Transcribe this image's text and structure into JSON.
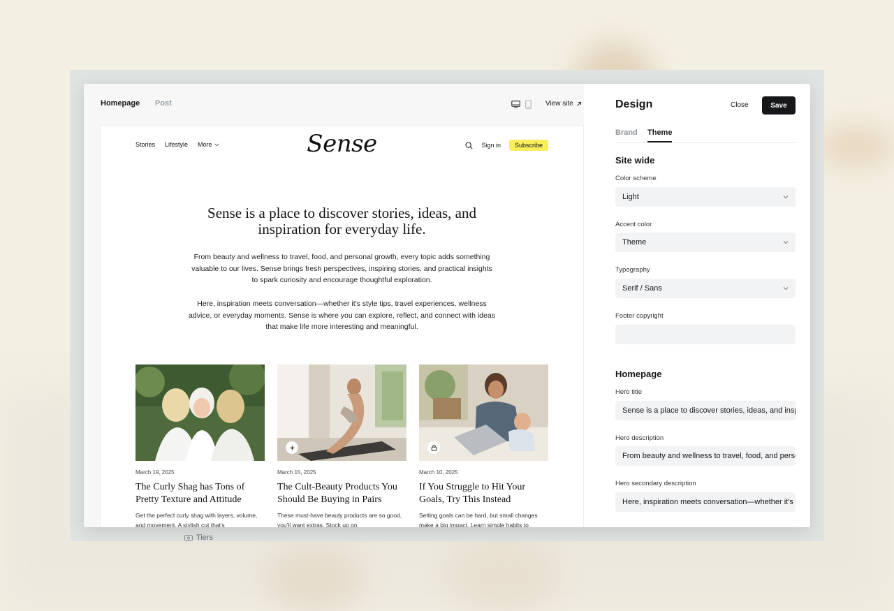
{
  "editor": {
    "tabs": [
      {
        "label": "Homepage"
      },
      {
        "label": "Post"
      }
    ],
    "view_site_label": "View site"
  },
  "site": {
    "nav": [
      {
        "label": "Stories"
      },
      {
        "label": "Lifestyle"
      },
      {
        "label": "More"
      }
    ],
    "logo": "Sense",
    "sign_in_label": "Sign in",
    "subscribe_label": "Subscribe",
    "subscribe_color": "#f9ee5c",
    "hero_title": "Sense is a place to discover stories, ideas, and inspiration for everyday life.",
    "hero_description": "From beauty and wellness to travel, food, and personal growth, every topic adds something valuable to our lives. Sense brings fresh perspectives, inspiring stories, and practical insights to spark curiosity and encourage thoughtful exploration.",
    "hero_secondary_description": "Here, inspiration meets conversation—whether it's style tips, travel experiences, wellness advice, or everyday moments. Sense is where you can explore, reflect, and connect with ideas that make life more interesting and meaningful.",
    "posts": [
      {
        "date": "March 19, 2025",
        "title": "The Curly Shag has Tons of Pretty Texture and Attitude",
        "excerpt": "Get the perfect curly shag with layers, volume, and movement. A stylish cut that's",
        "badge_icon": ""
      },
      {
        "date": "March 15, 2025",
        "title": "The Cult-Beauty Products You Should Be Buying in Pairs",
        "excerpt": "These must-have beauty products are so good, you'll want extras. Stock up on",
        "badge_icon": "sparkle-icon"
      },
      {
        "date": "March 10, 2025",
        "title": "If You Struggle to Hit Your Goals, Try This Instead",
        "excerpt": "Setting goals can be hard, but small changes make a big impact. Learn simple habits to",
        "badge_icon": "lock-icon"
      }
    ]
  },
  "design_panel": {
    "title": "Design",
    "close_label": "Close",
    "save_label": "Save",
    "tabs": [
      {
        "label": "Brand"
      },
      {
        "label": "Theme"
      }
    ],
    "active_tab": "Theme",
    "site_wide": {
      "title": "Site wide",
      "color_scheme_label": "Color scheme",
      "color_scheme_value": "Light",
      "accent_color_label": "Accent color",
      "accent_color_value": "Theme",
      "typography_label": "Typography",
      "typography_value": "Serif / Sans",
      "footer_copyright_label": "Footer copyright",
      "footer_copyright_value": ""
    },
    "homepage": {
      "title": "Homepage",
      "hero_title_label": "Hero title",
      "hero_title_value": "Sense is a place to discover stories, ideas, and inspiration for everyday life.",
      "hero_description_label": "Hero description",
      "hero_description_value": "From beauty and wellness to travel, food, and personal growth, every topic adds something",
      "hero_secondary_label": "Hero secondary description",
      "hero_secondary_value": "Here, inspiration meets conversation—whether it's style tips"
    }
  },
  "background": {
    "tiers_label": "Tiers"
  }
}
